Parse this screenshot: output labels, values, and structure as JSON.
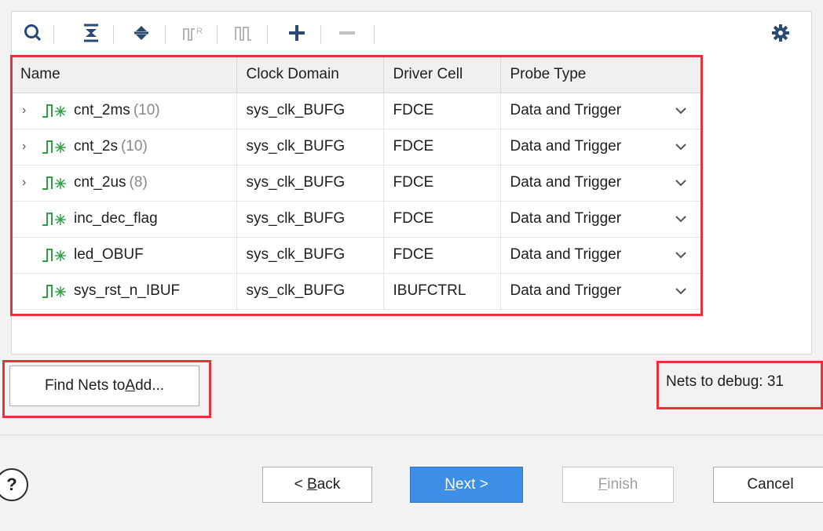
{
  "toolbar": {
    "icons": [
      "search-icon",
      "collapse-all-icon",
      "expand-all-icon",
      "group-bus-icon",
      "ungroup-bus-icon",
      "add-icon",
      "remove-icon",
      "gear-icon"
    ]
  },
  "table": {
    "columns": [
      "Name",
      "Clock Domain",
      "Driver Cell",
      "Probe Type"
    ],
    "rows": [
      {
        "name": "cnt_2ms",
        "count": "(10)",
        "expandable": true,
        "clock": "sys_clk_BUFG",
        "driver": "FDCE",
        "probe": "Data and Trigger"
      },
      {
        "name": "cnt_2s",
        "count": "(10)",
        "expandable": true,
        "clock": "sys_clk_BUFG",
        "driver": "FDCE",
        "probe": "Data and Trigger"
      },
      {
        "name": "cnt_2us",
        "count": "(8)",
        "expandable": true,
        "clock": "sys_clk_BUFG",
        "driver": "FDCE",
        "probe": "Data and Trigger"
      },
      {
        "name": "inc_dec_flag",
        "count": "",
        "expandable": false,
        "clock": "sys_clk_BUFG",
        "driver": "FDCE",
        "probe": "Data and Trigger"
      },
      {
        "name": "led_OBUF",
        "count": "",
        "expandable": false,
        "clock": "sys_clk_BUFG",
        "driver": "FDCE",
        "probe": "Data and Trigger"
      },
      {
        "name": "sys_rst_n_IBUF",
        "count": "",
        "expandable": false,
        "clock": "sys_clk_BUFG",
        "driver": "IBUFCTRL",
        "probe": "Data and Trigger"
      }
    ]
  },
  "find_nets": {
    "prefix": "Find Nets to ",
    "accel": "A",
    "suffix": "dd..."
  },
  "status": {
    "label": "Nets to debug: 31"
  },
  "footer": {
    "help": "?",
    "back": {
      "prefix": "< ",
      "accel": "B",
      "suffix": "ack"
    },
    "next": {
      "prefix": "",
      "accel": "N",
      "suffix": "ext >"
    },
    "finish": {
      "prefix": "",
      "accel": "F",
      "suffix": "inish"
    },
    "cancel": "Cancel"
  },
  "colors": {
    "highlight": "#e63339",
    "primary": "#3d8ee6",
    "net_icon": "#2ea043"
  }
}
